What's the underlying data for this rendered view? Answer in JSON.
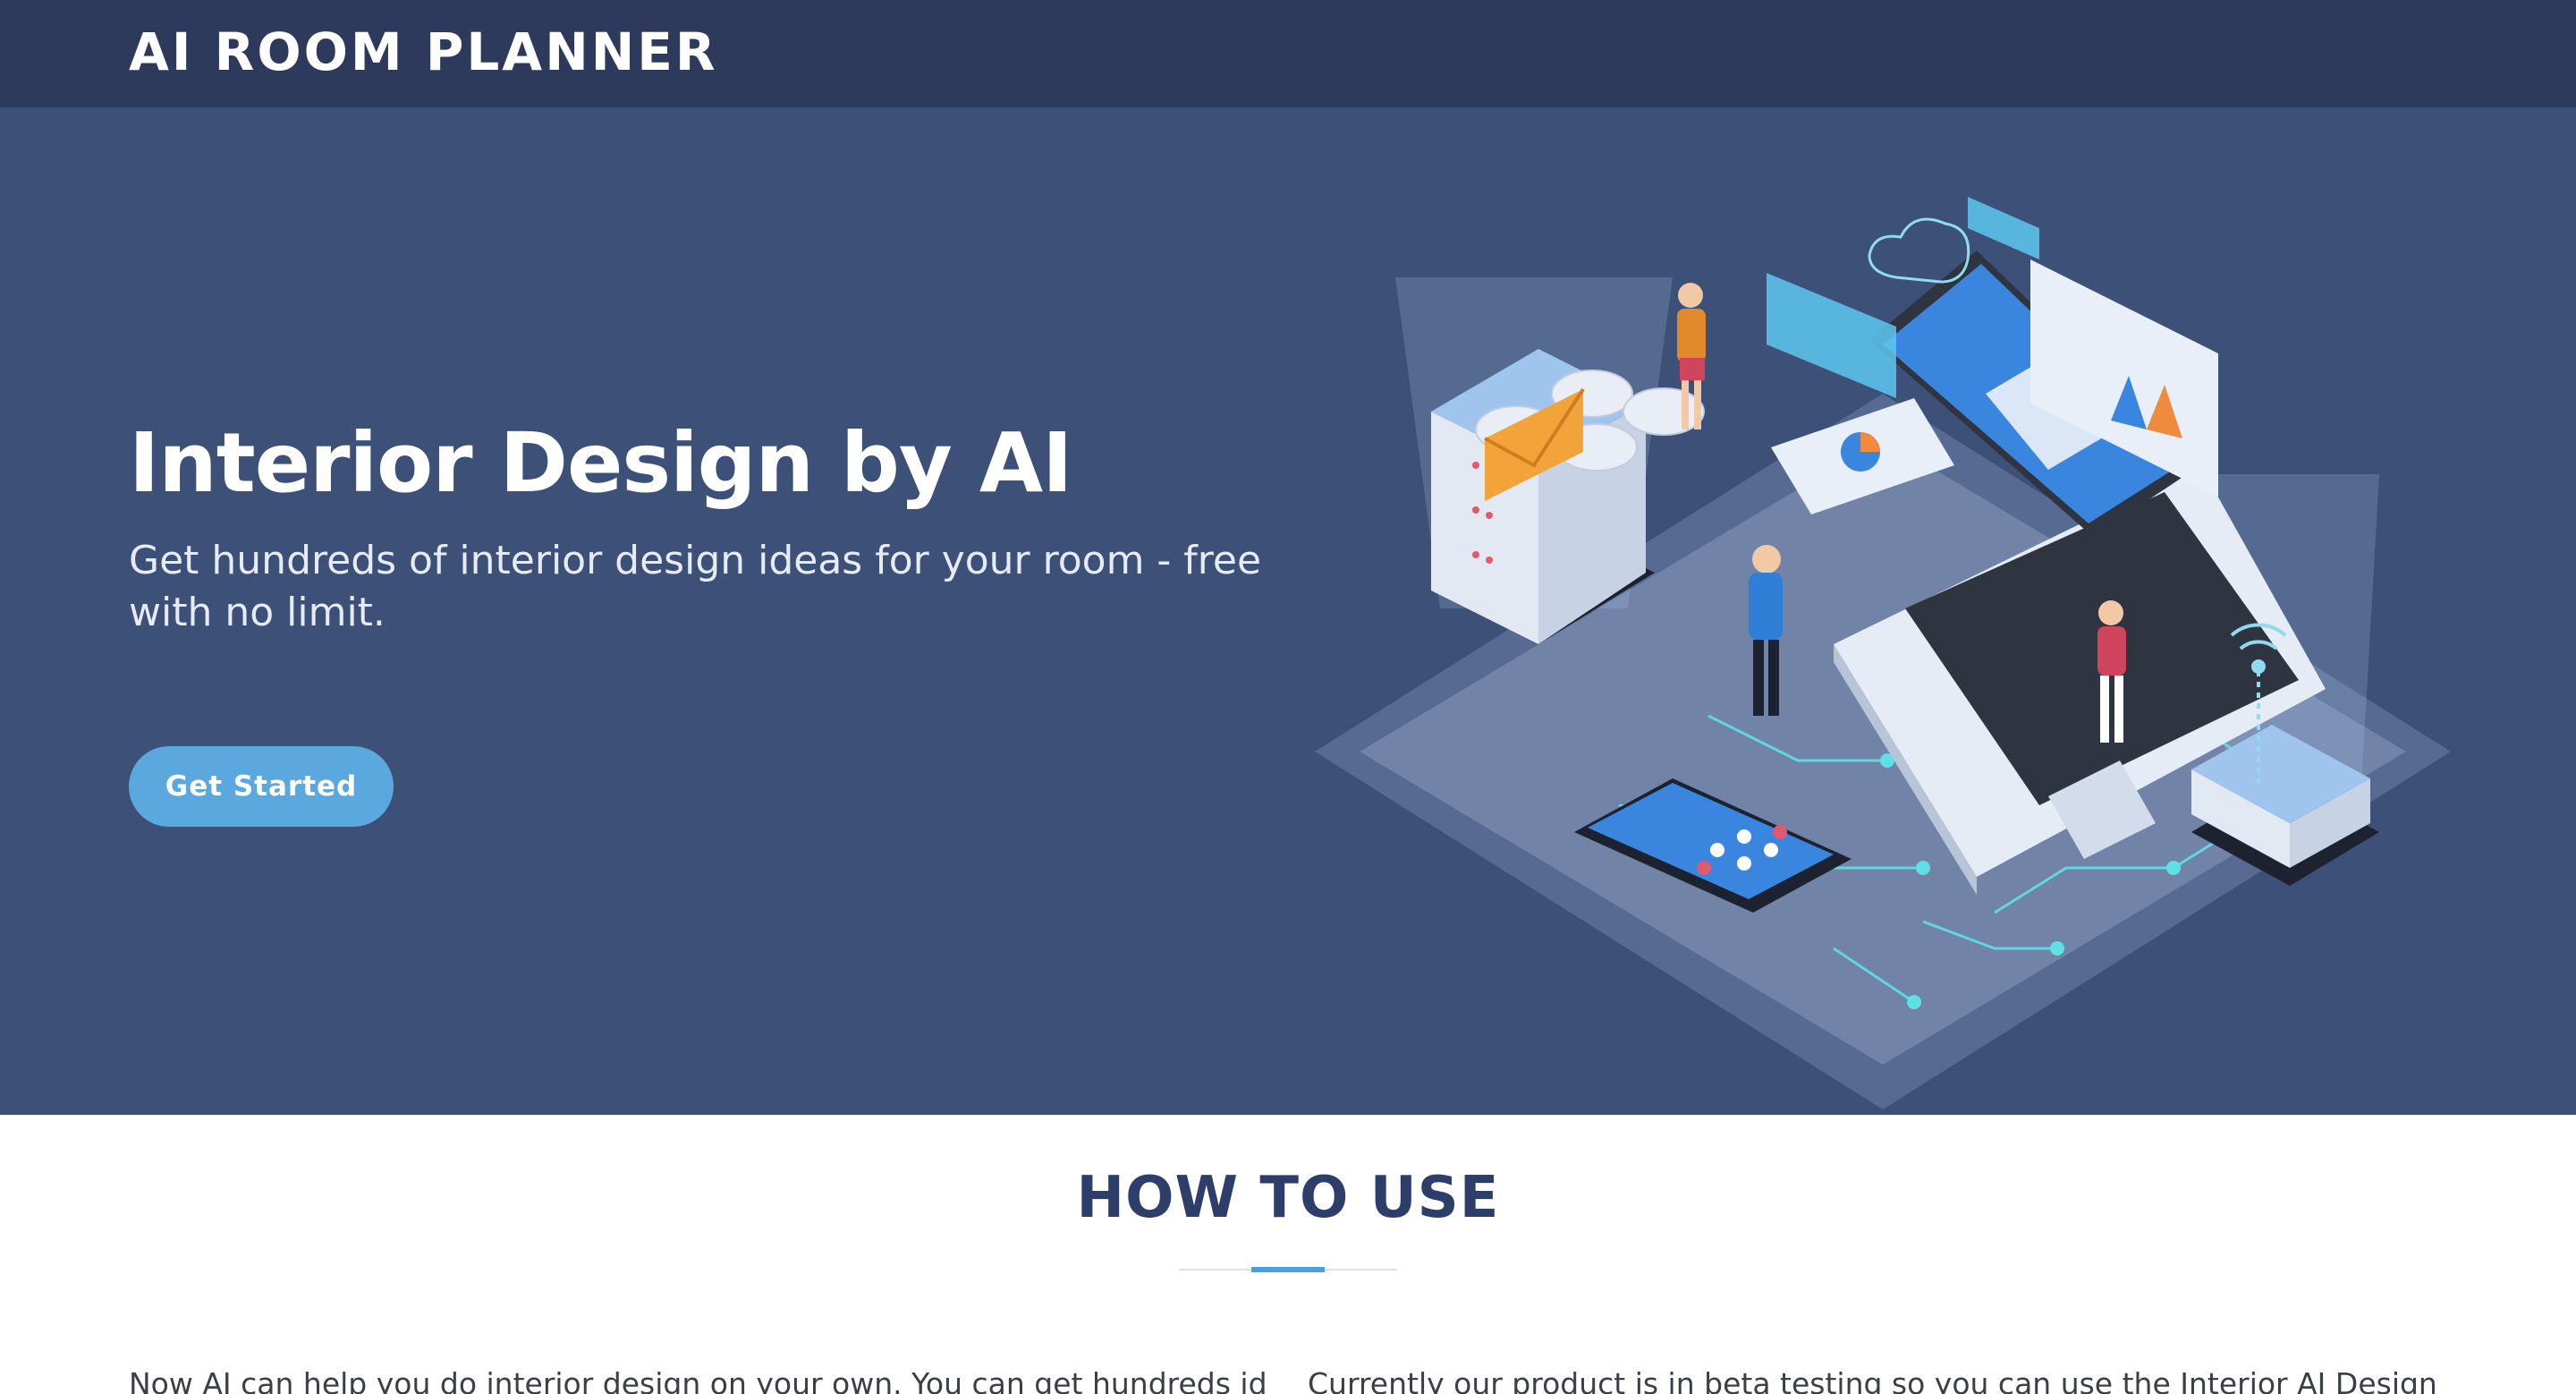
{
  "header": {
    "brand": "AI ROOM PLANNER"
  },
  "hero": {
    "title": "Interior Design by AI",
    "subtitle": "Get hundreds of interior design ideas for your room - free with no limit.",
    "cta_label": "Get Started"
  },
  "how_to_use": {
    "title": "HOW TO USE",
    "left_text": "Now AI can help you do interior design on your own. You can get hundreds ideas of",
    "right_text": "Currently our product is in beta testing so you can use the Interior AI Design free with"
  },
  "colors": {
    "header_bg": "#2d3a5c",
    "hero_bg": "#3d5078",
    "accent": "#5aa8de",
    "heading": "#2d3e6b"
  },
  "icons": [
    "envelope-icon",
    "cloud-icon",
    "wifi-icon",
    "pie-chart-icon",
    "bar-chart-icon"
  ]
}
